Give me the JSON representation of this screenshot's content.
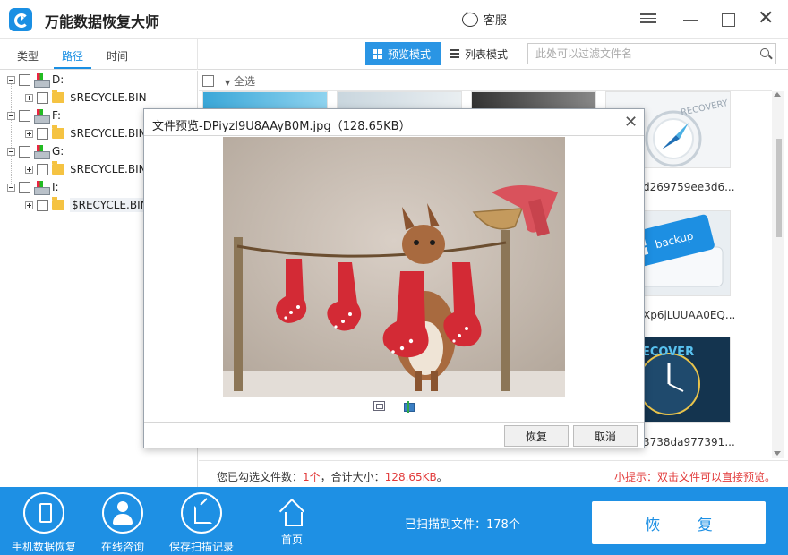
{
  "app": {
    "title": "万能数据恢复大师"
  },
  "titlebar": {
    "support_label": "客服"
  },
  "tabs": [
    {
      "label": "类型"
    },
    {
      "label": "路径"
    },
    {
      "label": "时间"
    }
  ],
  "view_modes": {
    "preview_label": "预览模式",
    "list_label": "列表模式"
  },
  "search": {
    "placeholder": "此处可以过滤文件名"
  },
  "tree": {
    "drives": [
      {
        "label": "D:",
        "child": "$RECYCLE.BIN"
      },
      {
        "label": "F:",
        "child": "$RECYCLE.BIN"
      },
      {
        "label": "G:",
        "child": "$RECYCLE.BIN"
      },
      {
        "label": "I:",
        "child": "$RECYCLE.BIN"
      }
    ]
  },
  "grid": {
    "select_all": "全选",
    "visible_labels": [
      "d269759ee3d6...",
      "Xp6jLUUAA0EQ...",
      "3738da977391..."
    ],
    "thumb_texts": [
      "RECOVERY",
      "backup",
      "ECOVER"
    ]
  },
  "status": {
    "prefix": "您已勾选文件数：",
    "count": "1个",
    "size_prefix": "，合计大小：",
    "size": "128.65KB",
    "suffix": "。",
    "tip": "小提示：双击文件可以直接预览。"
  },
  "modal": {
    "title": "文件预览-DPiyzl9U8AAyB0M.jpg（128.65KB）",
    "restore_label": "恢复",
    "cancel_label": "取消"
  },
  "bottom": {
    "phone_label": "手机数据恢复",
    "consult_label": "在线咨询",
    "save_label": "保存扫描记录",
    "home_label": "首页",
    "scanned_text": "已扫描到文件：178个",
    "recover_label": "恢 复"
  },
  "colors": {
    "accent": "#1e90e4",
    "alert": "#e23a3a"
  }
}
